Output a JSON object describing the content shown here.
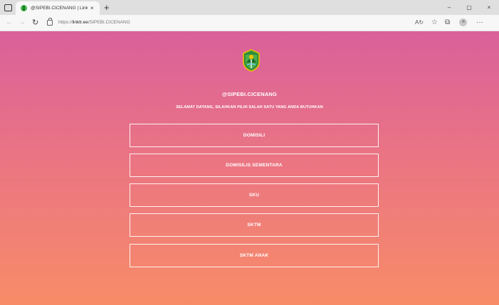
{
  "browser": {
    "tab_title": "@SIPEBI.CICENANG | Linktree",
    "tab_close": "×",
    "new_tab": "+",
    "window_controls": {
      "minimize": "–",
      "maximize": "▢",
      "close": "×"
    },
    "url_prefix": "https://",
    "url_host": "linktr.ee",
    "url_path": "/SIPEBI.CICENANG",
    "nav": {
      "back": "←",
      "forward": "→",
      "reload": "↻"
    },
    "toolbar_icons": {
      "read_aloud": "A↻",
      "favorites": "☆",
      "collections": "⧉",
      "more": "···"
    }
  },
  "profile": {
    "handle": "@SIPEBI.CICENANG",
    "tagline": "SELAMAT DATANG, SILAHKAN PILIH SALAH SATU YANG ANDA BUTUHKAN",
    "logo_icon": "regency-emblem-icon"
  },
  "links": [
    {
      "label": "DOMISILI"
    },
    {
      "label": "DOMISILIS SEMENTARA"
    },
    {
      "label": "SKU"
    },
    {
      "label": "SKTM"
    },
    {
      "label": "SKTM ANAK"
    }
  ],
  "colors": {
    "gradient_top": "#d9609b",
    "gradient_mid": "#ea7484",
    "gradient_bottom": "#f88c67",
    "link_text": "#ffffff"
  }
}
